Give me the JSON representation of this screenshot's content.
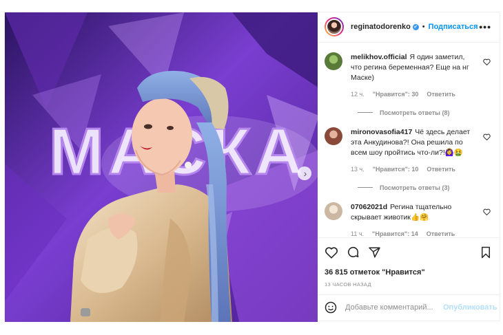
{
  "header": {
    "username": "reginatodorenko",
    "verified_mark": "✔",
    "separator": "•",
    "follow_label": "Подписаться",
    "more_label": "•••"
  },
  "photo": {
    "sign_text": "МАСКА",
    "next_icon": "›"
  },
  "comments": [
    {
      "user": "melikhov.official",
      "text": "Я один заметил, что регина беременная? Еще на нг Маске)",
      "time": "12 ч.",
      "likes": "\"Нравится\": 30",
      "reply": "Ответить",
      "view_replies": "Посмотреть ответы (8)",
      "avatar_color": "#5a7a3a"
    },
    {
      "user": "mironovasofia417",
      "text": "Чё здесь делает эта Анкудинова?! Она решила по всем шоу пройтись что-ли?!🙆‍♀️🤮",
      "time": "13 ч.",
      "likes": "\"Нравится\": 10",
      "reply": "Ответить",
      "view_replies": "Посмотреть ответы (3)",
      "avatar_color": "#8a4a3a"
    },
    {
      "user": "07062021d",
      "text": "Регина тщательно скрывает животик👍🤗",
      "time": "11 ч.",
      "likes": "\"Нравится\": 14",
      "reply": "Ответить",
      "avatar_color": "#d8c8b8"
    }
  ],
  "actions": {
    "likes_text": "36 815 отметок \"Нравится\"",
    "timestamp": "13 ЧАСОВ НАЗАД"
  },
  "add_comment": {
    "placeholder": "Добавьте комментарий...",
    "publish_label": "Опубликовать"
  },
  "colors": {
    "accent": "#0095f6",
    "muted": "#8e8e8e",
    "publish_disabled": "#b2dffc"
  }
}
